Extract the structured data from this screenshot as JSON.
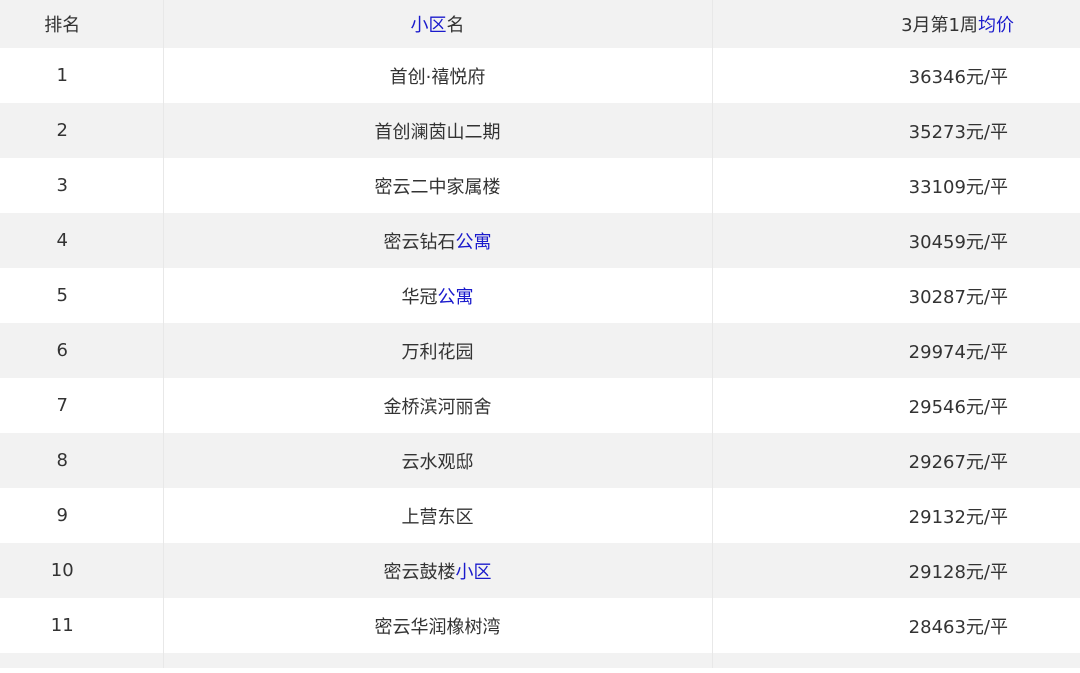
{
  "header": {
    "rank": "排名",
    "name_link": "小区",
    "name_suffix": "名",
    "price_prefix": "3月第1周",
    "price_link": "均价"
  },
  "rows": [
    {
      "rank": "1",
      "name": "首创·禧悦府",
      "name_link": "",
      "price": "36346元/平"
    },
    {
      "rank": "2",
      "name": "首创澜茵山二期",
      "name_link": "",
      "price": "35273元/平"
    },
    {
      "rank": "3",
      "name": "密云二中家属楼",
      "name_link": "",
      "price": "33109元/平"
    },
    {
      "rank": "4",
      "name": "密云钻石",
      "name_link": "公寓",
      "price": "30459元/平"
    },
    {
      "rank": "5",
      "name": "华冠",
      "name_link": "公寓",
      "price": "30287元/平"
    },
    {
      "rank": "6",
      "name": "万利花园",
      "name_link": "",
      "price": "29974元/平"
    },
    {
      "rank": "7",
      "name": "金桥滨河丽舍",
      "name_link": "",
      "price": "29546元/平"
    },
    {
      "rank": "8",
      "name": "云水观邸",
      "name_link": "",
      "price": "29267元/平"
    },
    {
      "rank": "9",
      "name": "上营东区",
      "name_link": "",
      "price": "29132元/平"
    },
    {
      "rank": "10",
      "name": "密云鼓楼",
      "name_link": "小区",
      "price": "29128元/平"
    },
    {
      "rank": "11",
      "name": "密云华润橡树湾",
      "name_link": "",
      "price": "28463元/平"
    }
  ],
  "colors": {
    "link": "#1a1acc",
    "stripe": "#f2f2f2",
    "text": "#333333"
  }
}
